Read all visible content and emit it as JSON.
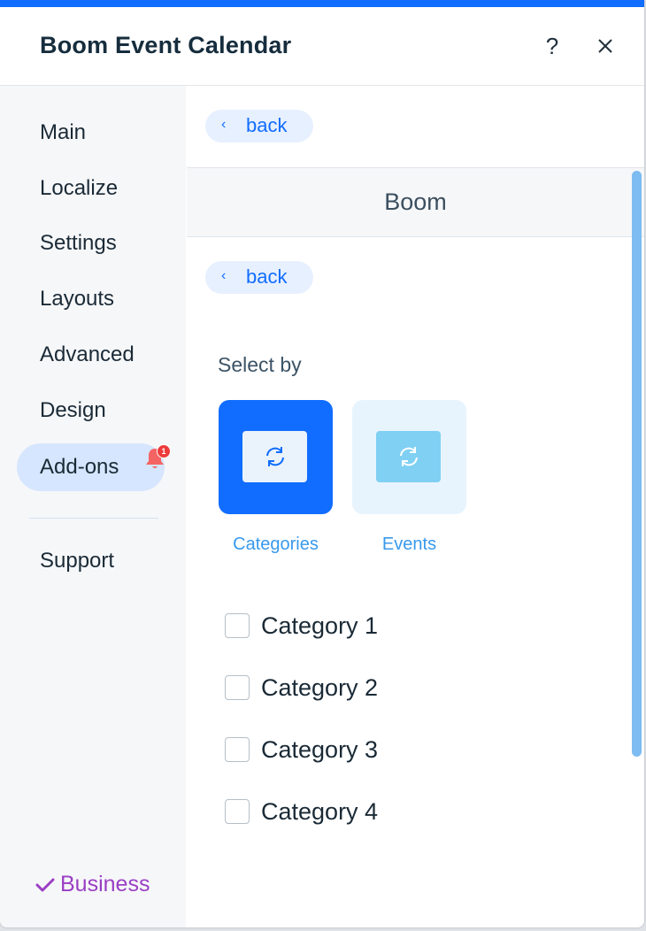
{
  "header": {
    "title": "Boom Event Calendar",
    "help_label": "?",
    "icons": {
      "help": "question-mark-icon",
      "close": "close-icon"
    }
  },
  "sidebar": {
    "items": [
      {
        "label": "Main",
        "active": false
      },
      {
        "label": "Localize",
        "active": false
      },
      {
        "label": "Settings",
        "active": false
      },
      {
        "label": "Layouts",
        "active": false
      },
      {
        "label": "Advanced",
        "active": false
      },
      {
        "label": "Design",
        "active": false
      },
      {
        "label": "Add-ons",
        "active": true
      }
    ],
    "notification_count": "1",
    "support_label": "Support",
    "plan_label": "Business"
  },
  "main": {
    "back_label_top": "back",
    "section_title": "Boom",
    "back_label_inner": "back",
    "select_by_label": "Select by",
    "choices": [
      {
        "label": "Categories",
        "selected": true
      },
      {
        "label": "Events",
        "selected": false
      }
    ],
    "categories": [
      {
        "label": "Category 1",
        "checked": false
      },
      {
        "label": "Category 2",
        "checked": false
      },
      {
        "label": "Category 3",
        "checked": false
      },
      {
        "label": "Category 4",
        "checked": false
      }
    ]
  },
  "colors": {
    "accent": "#116dff",
    "active_nav_bg": "#d6e6fe",
    "link": "#3899ec",
    "plan": "#9a3fc4",
    "badge": "#ee3b3b"
  }
}
